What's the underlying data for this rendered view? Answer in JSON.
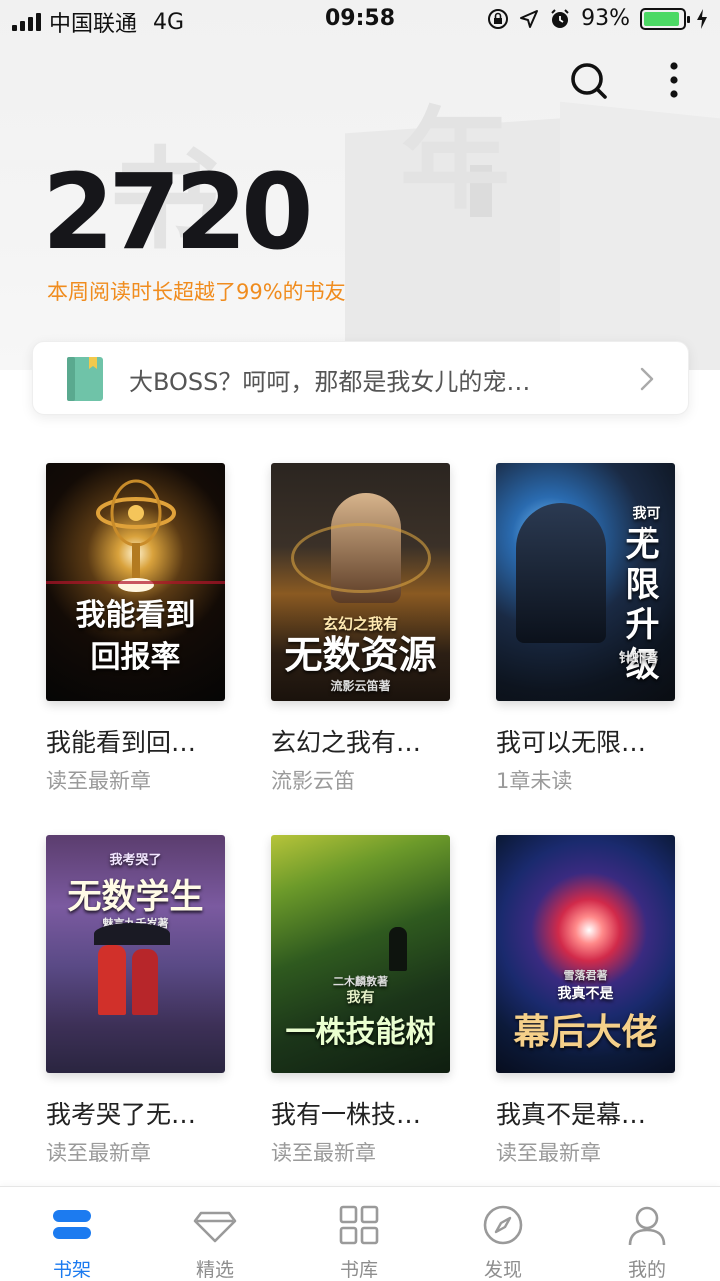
{
  "status_bar": {
    "carrier": "中国联通",
    "network": "4G",
    "time": "09:58",
    "battery": "93%"
  },
  "header": {
    "icons": [
      "search-icon",
      "more-icon"
    ]
  },
  "stats": {
    "reading_value": "2720",
    "reading_caption": "本周阅读时长超越了99%的书友",
    "caption_color": "#f08c1e"
  },
  "recent": {
    "title": "大BOSS？呵呵，那都是我女儿的宠…"
  },
  "books": [
    {
      "title": "我能看到回…",
      "subtitle": "读至最新章",
      "cover_text": "我能看到回报率"
    },
    {
      "title": "玄幻之我有…",
      "subtitle": "流影云笛",
      "cover_text": "无数资源",
      "cover_top": "玄幻之我有",
      "cover_author": "流影云笛著"
    },
    {
      "title": "我可以无限…",
      "subtitle": "1章未读",
      "cover_text": "无限升级",
      "cover_top": "我可以",
      "cover_author": "针虾著"
    },
    {
      "title": "我考哭了无…",
      "subtitle": "读至最新章",
      "cover_text": "无数学生",
      "cover_top": "我考哭了",
      "cover_author": "魅言九千岁著"
    },
    {
      "title": "我有一株技…",
      "subtitle": "读至最新章",
      "cover_text": "一株技能树",
      "cover_top": "我有",
      "cover_author": "二木麟敦著"
    },
    {
      "title": "我真不是幕…",
      "subtitle": "读至最新章",
      "cover_text": "幕后大佬",
      "cover_top": "我真不是",
      "cover_author": "雪落君著"
    }
  ],
  "tabs": [
    {
      "label": "书架",
      "icon": "bookshelf-icon",
      "active": true
    },
    {
      "label": "精选",
      "icon": "diamond-icon",
      "active": false
    },
    {
      "label": "书库",
      "icon": "grid-icon",
      "active": false
    },
    {
      "label": "发现",
      "icon": "compass-icon",
      "active": false
    },
    {
      "label": "我的",
      "icon": "profile-icon",
      "active": false
    }
  ],
  "colors": {
    "accent": "#1c7bf0",
    "battery": "#4cd964"
  }
}
